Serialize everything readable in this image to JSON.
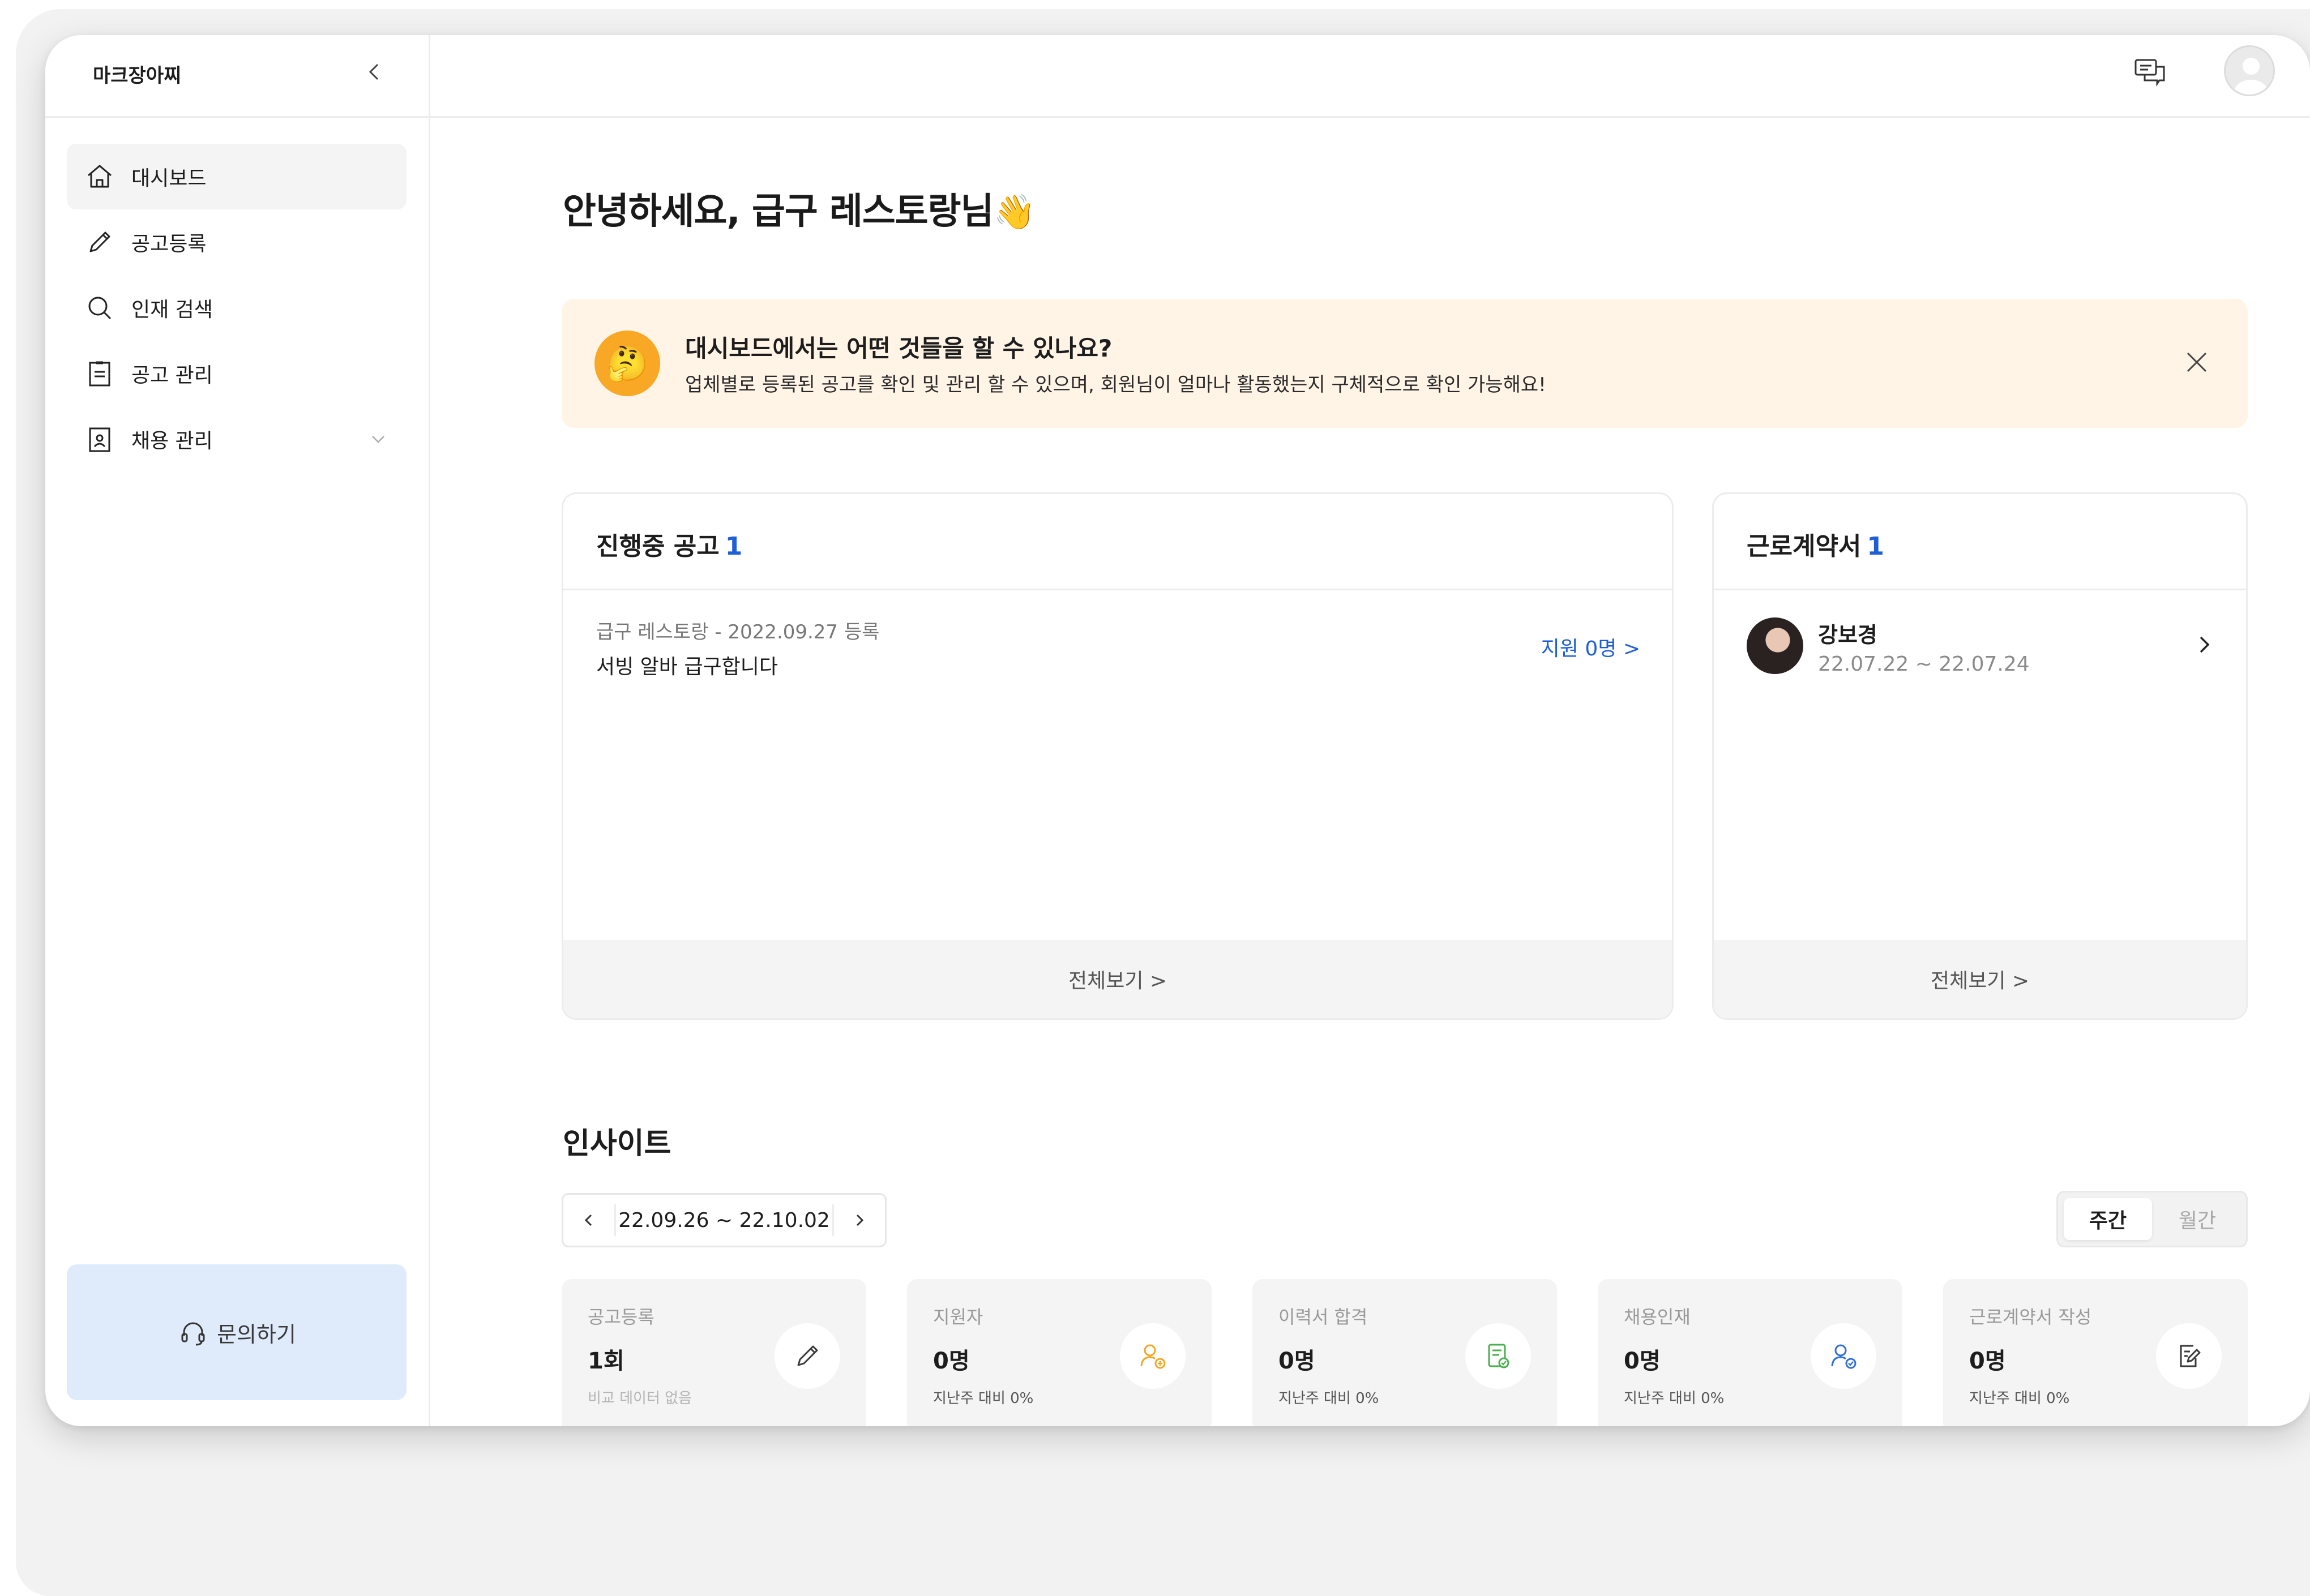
{
  "sidebar": {
    "brand": "마크장아찌",
    "collapse_icon": "<",
    "items": [
      {
        "label": "대시보드",
        "icon": "home-icon",
        "active": true
      },
      {
        "label": "공고등록",
        "icon": "pencil-icon"
      },
      {
        "label": "인재 검색",
        "icon": "search-icon"
      },
      {
        "label": "공고 관리",
        "icon": "document-icon"
      },
      {
        "label": "채용 관리",
        "icon": "id-card-icon",
        "expandable": true
      }
    ],
    "help_label": "문의하기"
  },
  "main": {
    "greeting": "안녕하세요, 급구 레스토랑님",
    "greeting_emoji": "👋",
    "banner": {
      "title": "대시보드에서는 어떤 것들을 할 수 있나요?",
      "description": "업체별로 등록된 공고를 확인 및 관리 할 수 있으며, 회원님이 얼마나 활동했는지 구체적으로 확인 가능해요!",
      "emoji": "🤔"
    },
    "active_jobs": {
      "title": "진행중 공고",
      "count": "1",
      "item_meta": "급구 레스토랑 - 2022.09.27 등록",
      "item_title": "서빙 알바 급구합니다",
      "apply_label": "지원 0명 >",
      "footer": "전체보기 >"
    },
    "contracts": {
      "title": "근로계약서",
      "count": "1",
      "name": "강보경",
      "period": "22.07.22 ~ 22.07.24",
      "footer": "전체보기 >"
    },
    "insights": {
      "title": "인사이트",
      "date_range": "22.09.26 ~ 22.10.02",
      "toggle": {
        "weekly": "주간",
        "monthly": "월간",
        "selected": "weekly"
      },
      "stats": [
        {
          "label": "공고등록",
          "value": "1회",
          "sub": "비교 데이터 없음",
          "icon": "pencil-icon",
          "color": "#3a3a3a"
        },
        {
          "label": "지원자",
          "value": "0명",
          "sub": "지난주 대비 0%",
          "icon": "user-add-icon",
          "color": "#f5a623"
        },
        {
          "label": "이력서 합격",
          "value": "0명",
          "sub": "지난주 대비 0%",
          "icon": "resume-check-icon",
          "color": "#4caf50"
        },
        {
          "label": "채용인재",
          "value": "0명",
          "sub": "지난주 대비 0%",
          "icon": "user-check-icon",
          "color": "#2f6ed8"
        },
        {
          "label": "근로계약서 작성",
          "value": "0명",
          "sub": "지난주 대비 0%",
          "icon": "contract-edit-icon",
          "color": "#3a3a3a"
        }
      ]
    }
  },
  "colors": {
    "accent": "#1f5fd6",
    "banner_bg": "#fff4e6",
    "help_bg": "#dfeafb"
  }
}
